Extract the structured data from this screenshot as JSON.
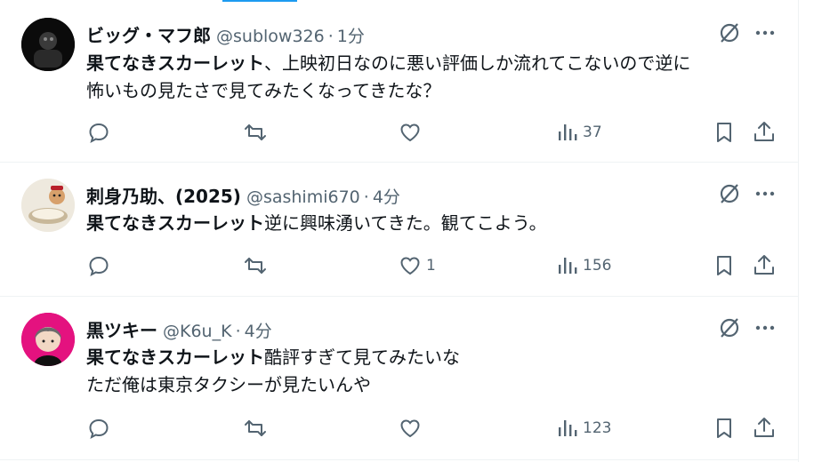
{
  "colors": {
    "text": "#0f1419",
    "muted": "#536471",
    "accent": "#1d9bf0",
    "border": "#eff3f4"
  },
  "tweets": [
    {
      "name": "ビッグ・マフ郎",
      "handle": "@sublow326",
      "time": "1分",
      "movie": "果てなきスカーレット",
      "text_line1": "、上映初日なのに悪い評価しか流れてこないので逆に",
      "text_line2": "怖いもの見たさで見てみたくなってきたな？",
      "replies": "",
      "retweets": "",
      "likes": "",
      "views": "37",
      "avatar_icon": "dark-photo-avatar"
    },
    {
      "name": "刺身乃助、(2025)",
      "handle": "@sashimi670",
      "time": "4分",
      "movie": "果てなきスカーレット",
      "text_line1": "逆に興味湧いてきた。観てこよう。",
      "text_line2": "",
      "replies": "",
      "retweets": "",
      "likes": "1",
      "views": "156",
      "avatar_icon": "food-character-avatar"
    },
    {
      "name": "黒ツキー",
      "handle": "@K6u_K",
      "time": "4分",
      "movie": "果てなきスカーレット",
      "text_line1": "酷評すぎて見てみたいな",
      "text_line2": "ただ俺は東京タクシーが見たいんや",
      "replies": "",
      "retweets": "",
      "likes": "",
      "views": "123",
      "avatar_icon": "pink-illustration-avatar"
    }
  ],
  "separator": "·"
}
